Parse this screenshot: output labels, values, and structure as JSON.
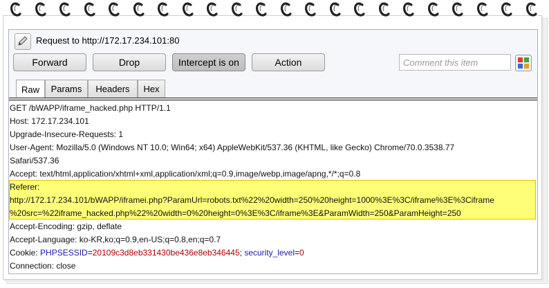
{
  "window": {
    "title": "Request to http://172.17.234.101:80"
  },
  "toolbar": {
    "forward_label": "Forward",
    "drop_label": "Drop",
    "intercept_label": "Intercept is on",
    "action_label": "Action",
    "comment_placeholder": "Comment this item"
  },
  "tabs": [
    {
      "label": "Raw",
      "selected": true
    },
    {
      "label": "Params",
      "selected": false
    },
    {
      "label": "Headers",
      "selected": false
    },
    {
      "label": "Hex",
      "selected": false
    }
  ],
  "request": {
    "lines": [
      "GET /bWAPP/iframe_hacked.php HTTP/1.1",
      "Host: 172.17.234.101",
      "Upgrade-Insecure-Requests: 1",
      "User-Agent: Mozilla/5.0 (Windows NT 10.0; Win64; x64) AppleWebKit/537.36 (KHTML, like Gecko) Chrome/70.0.3538.77",
      "Safari/537.36",
      "Accept: text/html,application/xhtml+xml,application/xml;q=0.9,image/webp,image/apng,*/*;q=0.8",
      "Referer:",
      "http://172.17.234.101/bWAPP/iframei.php?ParamUrl=robots.txt%22%20width=250%20height=1000%3E%3C/iframe%3E%3Ciframe",
      "%20src=%22iframe_hacked.php%22%20width=0%20height=0%3E%3C/iframe%3E&ParamWidth=250&ParamHeight=250",
      "Accept-Encoding: gzip, deflate",
      "Accept-Language: ko-KR,ko;q=0.9,en-US;q=0.8,en;q=0.7"
    ],
    "cookie": {
      "prefix": "Cookie: ",
      "name1": "PHPSESSID",
      "eq1": "=",
      "value1": "20109c3d8eb331430be436e8eb346445",
      "sep": "; ",
      "name2": "security_level",
      "eq2": "=",
      "value2": "0"
    },
    "last_line": "Connection: close"
  },
  "colors": {
    "highlight": "#ffff77",
    "cookie_name": "#1a1aa6",
    "cookie_value": "#b00000"
  },
  "icons": [
    "edit-icon",
    "color-grid-icon",
    "spiral-ring-icon"
  ]
}
